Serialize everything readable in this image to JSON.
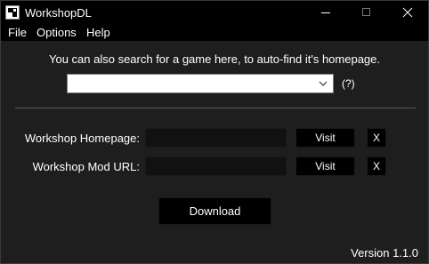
{
  "window": {
    "title": "WorkshopDL",
    "controls": {
      "minimize_icon": "minimize-icon",
      "maximize_icon": "maximize-icon",
      "close_icon": "close-icon"
    }
  },
  "menu": {
    "items": [
      "File",
      "Options",
      "Help"
    ]
  },
  "main": {
    "info_text": "You can also search for a game here, to auto-find it's homepage.",
    "search": {
      "value": "",
      "placeholder": ""
    },
    "help_text": "(?)",
    "homepage_label": "Workshop Homepage:",
    "homepage_value": "",
    "mod_url_label": "Workshop Mod URL:",
    "mod_url_value": "",
    "visit_label": "Visit",
    "clear_label": "X",
    "download_label": "Download",
    "version_text": "Version 1.1.0"
  },
  "colors": {
    "background": "#1e1e1e",
    "titlebar": "#000000",
    "button": "#000000",
    "input_dark": "#111111",
    "text": "#ffffff"
  }
}
